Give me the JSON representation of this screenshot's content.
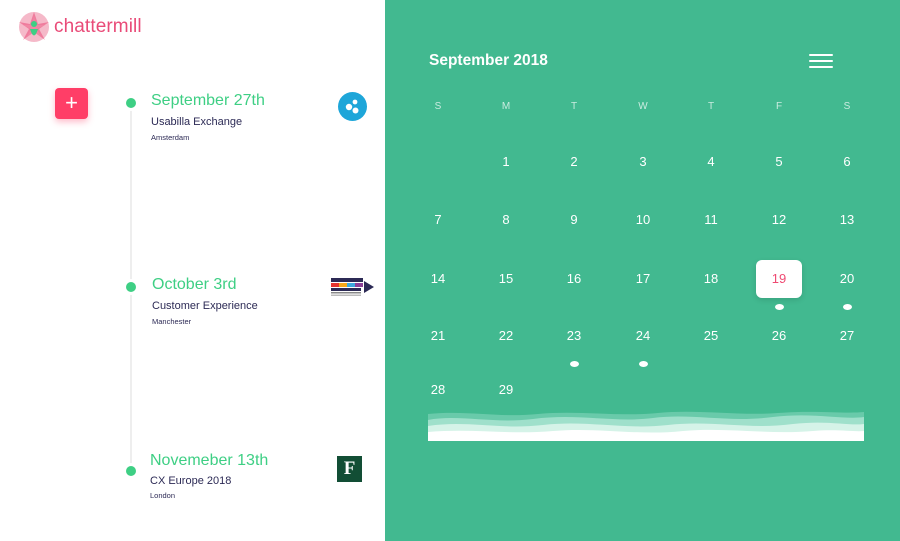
{
  "brand": {
    "name": "chattermill",
    "color": "#e94b78"
  },
  "add_button": {
    "label": "+"
  },
  "events": [
    {
      "date": "September 27th",
      "title": "Usabilla Exchange",
      "location": "Amsterdam",
      "logo_icon": "usabilla-logo-icon"
    },
    {
      "date": "October 3rd",
      "title": "Customer Experience",
      "location": "Manchester",
      "logo_icon": "customer-experience-manchester-logo-icon"
    },
    {
      "date": "Novemeber 13th",
      "title": "CX Europe 2018",
      "location": "London",
      "logo_icon": "forrester-f-logo-icon"
    }
  ],
  "event_logos": {
    "forrester_letter": "F"
  },
  "calendar": {
    "month_label": "September 2018",
    "weekday_labels": [
      "S",
      "M",
      "T",
      "W",
      "T",
      "F",
      "S"
    ],
    "weeks": [
      [
        "",
        "1",
        "2",
        "3",
        "4",
        "5",
        "6"
      ],
      [
        "7",
        "8",
        "9",
        "10",
        "11",
        "12",
        "13"
      ],
      [
        "14",
        "15",
        "16",
        "17",
        "18",
        "19",
        "20"
      ],
      [
        "21",
        "22",
        "23",
        "24",
        "25",
        "26",
        "27"
      ],
      [
        "28",
        "29",
        "",
        "",
        "",
        "",
        ""
      ]
    ],
    "selected_day": "19",
    "days_with_events": [
      "19",
      "20",
      "23",
      "24"
    ],
    "menu_icon": "hamburger-menu-icon",
    "colors": {
      "background": "#42b990",
      "accent": "#3ecf84",
      "selected_text": "#ef4a72",
      "add_button": "#ff3e67"
    }
  }
}
